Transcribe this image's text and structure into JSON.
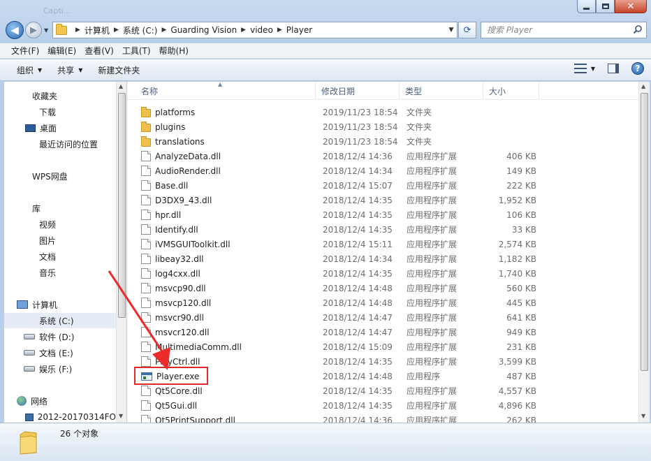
{
  "window": {
    "title_ghost": "Capti...",
    "close_glyph": "✕"
  },
  "nav": {
    "back_glyph": "◀",
    "forward_glyph": "▶",
    "breadcrumbs": [
      "计算机",
      "系统 (C:)",
      "Guarding Vision",
      "video",
      "Player"
    ],
    "search_placeholder": "搜索 Player"
  },
  "menu": [
    "文件(F)",
    "编辑(E)",
    "查看(V)",
    "工具(T)",
    "帮助(H)"
  ],
  "toolbar": {
    "organize": "组织",
    "share": "共享",
    "new_folder": "新建文件夹"
  },
  "sidebar": {
    "favorites": "收藏夹",
    "downloads": "下载",
    "desktop": "桌面",
    "recent": "最近访问的位置",
    "wps": "WPS网盘",
    "libraries": "库",
    "videos": "视频",
    "pictures": "图片",
    "documents": "文档",
    "music": "音乐",
    "computer": "计算机",
    "drive_c": "系统 (C:)",
    "drive_d": "软件 (D:)",
    "drive_e": "文档 (E:)",
    "drive_f": "娱乐 (F:)",
    "network": "网络",
    "network_pc": "2012-20170314FO"
  },
  "columns": {
    "name": "名称",
    "date": "修改日期",
    "type": "类型",
    "size": "大小"
  },
  "files": [
    {
      "name": "platforms",
      "date": "2019/11/23 18:54",
      "type": "文件夹",
      "size": "",
      "kind": "folder"
    },
    {
      "name": "plugins",
      "date": "2019/11/23 18:54",
      "type": "文件夹",
      "size": "",
      "kind": "folder"
    },
    {
      "name": "translations",
      "date": "2019/11/23 18:54",
      "type": "文件夹",
      "size": "",
      "kind": "folder"
    },
    {
      "name": "AnalyzeData.dll",
      "date": "2018/12/4 14:36",
      "type": "应用程序扩展",
      "size": "406 KB",
      "kind": "dll"
    },
    {
      "name": "AudioRender.dll",
      "date": "2018/12/4 14:34",
      "type": "应用程序扩展",
      "size": "149 KB",
      "kind": "dll"
    },
    {
      "name": "Base.dll",
      "date": "2018/12/4 15:07",
      "type": "应用程序扩展",
      "size": "222 KB",
      "kind": "dll"
    },
    {
      "name": "D3DX9_43.dll",
      "date": "2018/12/4 14:35",
      "type": "应用程序扩展",
      "size": "1,952 KB",
      "kind": "dll"
    },
    {
      "name": "hpr.dll",
      "date": "2018/12/4 14:35",
      "type": "应用程序扩展",
      "size": "106 KB",
      "kind": "dll"
    },
    {
      "name": "Identify.dll",
      "date": "2018/12/4 14:35",
      "type": "应用程序扩展",
      "size": "33 KB",
      "kind": "dll"
    },
    {
      "name": "iVMSGUIToolkit.dll",
      "date": "2018/12/4 15:11",
      "type": "应用程序扩展",
      "size": "2,574 KB",
      "kind": "dll"
    },
    {
      "name": "libeay32.dll",
      "date": "2018/12/4 14:34",
      "type": "应用程序扩展",
      "size": "1,182 KB",
      "kind": "dll"
    },
    {
      "name": "log4cxx.dll",
      "date": "2018/12/4 14:35",
      "type": "应用程序扩展",
      "size": "1,740 KB",
      "kind": "dll"
    },
    {
      "name": "msvcp90.dll",
      "date": "2018/12/4 14:48",
      "type": "应用程序扩展",
      "size": "560 KB",
      "kind": "dll"
    },
    {
      "name": "msvcp120.dll",
      "date": "2018/12/4 14:48",
      "type": "应用程序扩展",
      "size": "445 KB",
      "kind": "dll"
    },
    {
      "name": "msvcr90.dll",
      "date": "2018/12/4 14:47",
      "type": "应用程序扩展",
      "size": "641 KB",
      "kind": "dll"
    },
    {
      "name": "msvcr120.dll",
      "date": "2018/12/4 14:47",
      "type": "应用程序扩展",
      "size": "949 KB",
      "kind": "dll"
    },
    {
      "name": "MultimediaComm.dll",
      "date": "2018/12/4 15:09",
      "type": "应用程序扩展",
      "size": "231 KB",
      "kind": "dll"
    },
    {
      "name": "PlayCtrl.dll",
      "date": "2018/12/4 14:35",
      "type": "应用程序扩展",
      "size": "3,599 KB",
      "kind": "dll"
    },
    {
      "name": "Player.exe",
      "date": "2018/12/4 14:48",
      "type": "应用程序",
      "size": "487 KB",
      "kind": "exe"
    },
    {
      "name": "Qt5Core.dll",
      "date": "2018/12/4 14:35",
      "type": "应用程序扩展",
      "size": "4,557 KB",
      "kind": "dll"
    },
    {
      "name": "Qt5Gui.dll",
      "date": "2018/12/4 14:35",
      "type": "应用程序扩展",
      "size": "4,896 KB",
      "kind": "dll"
    },
    {
      "name": "Qt5PrintSupport.dll",
      "date": "2018/12/4 14:36",
      "type": "应用程序扩展",
      "size": "262 KB",
      "kind": "dll"
    }
  ],
  "status": {
    "count": "26 个对象"
  }
}
